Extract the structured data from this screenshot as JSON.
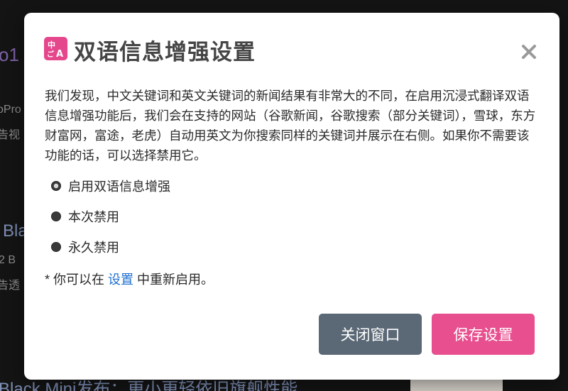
{
  "background": {
    "fragment_a": "o1",
    "fragment_b": "oPro",
    "fragment_c": "告视",
    "fragment_d": "Bla",
    "fragment_e": "2 B",
    "fragment_f": "告透",
    "fragment_g": "Black Mini发布：更小更轻依旧旗舰性能"
  },
  "modal": {
    "title": "双语信息增强设置",
    "description": "我们发现，中文关键词和英文关键词的新闻结果有非常大的不同，在启用沉浸式翻译双语信息增强功能后，我们会在支持的网站（谷歌新闻，谷歌搜索（部分关键词），雪球，东方财富网，富途，老虎）自动用英文为你搜索同样的关键词并展示在右侧。如果你不需要该功能的话，可以选择禁用它。",
    "options": [
      {
        "label": "启用双语信息增强",
        "checked": true
      },
      {
        "label": "本次禁用",
        "checked": false
      },
      {
        "label": "永久禁用",
        "checked": false
      }
    ],
    "note_prefix": "* 你可以在 ",
    "note_link": "设置",
    "note_suffix": " 中重新启用。",
    "close_button": "关闭窗口",
    "save_button": "保存设置"
  },
  "colors": {
    "brand": "#e5478c",
    "save_button": "#e84f8f",
    "close_button": "#5b6875",
    "link": "#1e6fd0"
  },
  "icons": {
    "logo": "immersive-translate-logo-icon",
    "close": "close-icon"
  }
}
